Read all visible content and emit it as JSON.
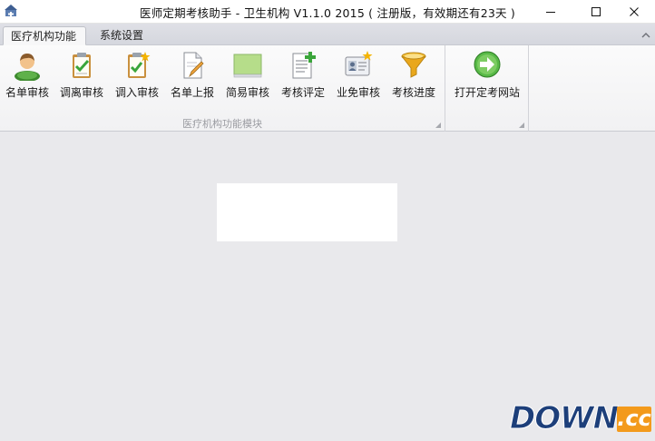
{
  "window": {
    "title": "医师定期考核助手 - 卫生机构 V1.1.0 2015 ( 注册版，有效期还有23天 )"
  },
  "tabs": [
    {
      "label": "医疗机构功能",
      "active": true
    },
    {
      "label": "系统设置",
      "active": false
    }
  ],
  "ribbon": {
    "group1": {
      "label": "医疗机构功能模块",
      "buttons": [
        {
          "label": "名单审核",
          "icon": "person-icon"
        },
        {
          "label": "调离审核",
          "icon": "clipboard-check-icon"
        },
        {
          "label": "调入审核",
          "icon": "clipboard-star-icon"
        },
        {
          "label": "名单上报",
          "icon": "document-pen-icon"
        },
        {
          "label": "简易审核",
          "icon": "green-panel-icon"
        },
        {
          "label": "考核评定",
          "icon": "document-plus-icon"
        },
        {
          "label": "业免审核",
          "icon": "id-card-star-icon"
        },
        {
          "label": "考核进度",
          "icon": "funnel-icon"
        }
      ]
    },
    "group2": {
      "label": "",
      "buttons": [
        {
          "label": "打开定考网站",
          "icon": "green-arrow-icon"
        }
      ]
    }
  },
  "watermark": {
    "main": "DOWN",
    "tld": ".cc"
  },
  "colors": {
    "background": "#e9e9ec",
    "ribbon": "#f7f7f8",
    "watermark_blue": "#1d3f7a",
    "watermark_orange": "#f39a1c"
  }
}
